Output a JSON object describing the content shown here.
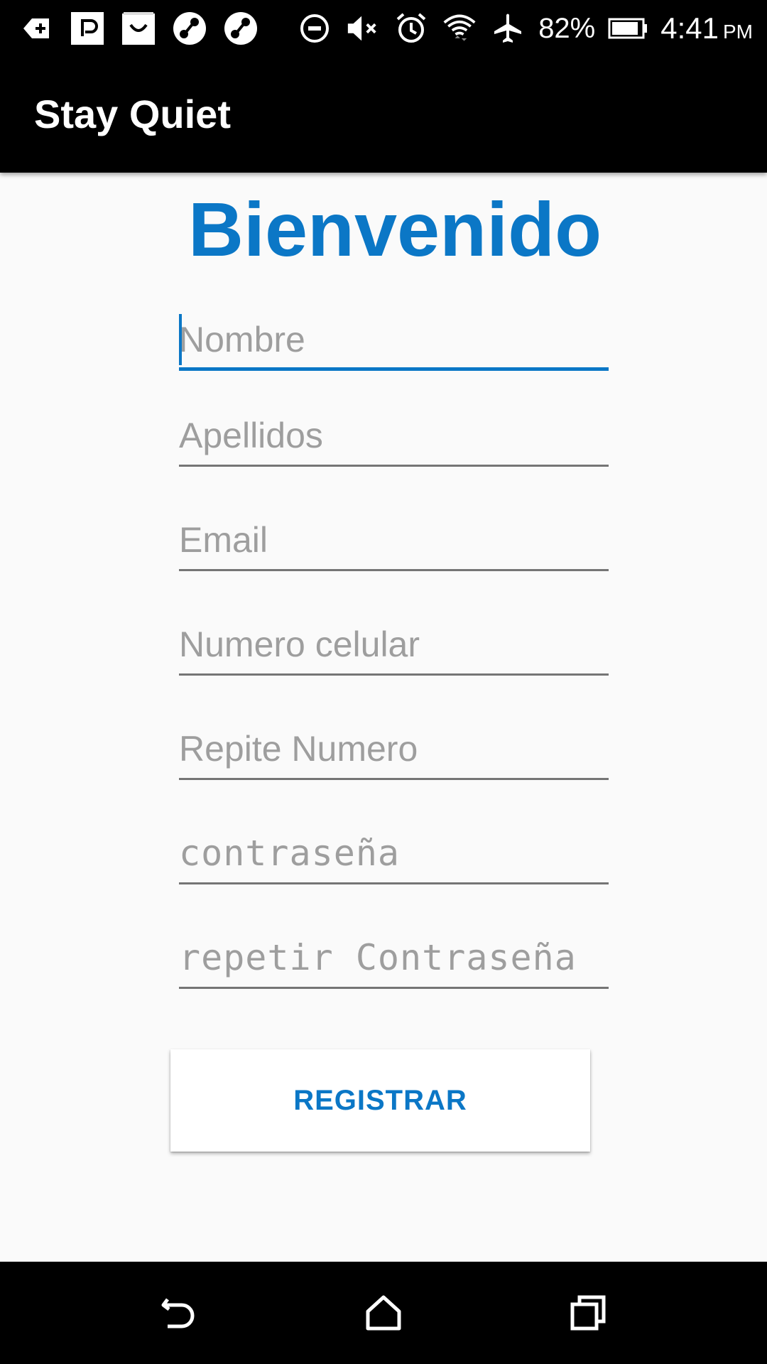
{
  "status_bar": {
    "battery_percent": "82%",
    "time": "4:41",
    "ampm": "PM",
    "left_icons": [
      "notification-plus-icon",
      "app-notification-icon",
      "shopping-bag-icon",
      "music-app-icon",
      "music-app-icon"
    ],
    "right_icons": [
      "do-not-disturb-icon",
      "mute-icon",
      "alarm-icon",
      "wifi-icon",
      "airplane-mode-icon",
      "battery-icon"
    ]
  },
  "app_bar": {
    "title": "Stay Quiet"
  },
  "form": {
    "heading": "Bienvenido",
    "fields": [
      {
        "placeholder": "Nombre",
        "value": ""
      },
      {
        "placeholder": "Apellidos",
        "value": ""
      },
      {
        "placeholder": "Email",
        "value": ""
      },
      {
        "placeholder": "Numero celular",
        "value": ""
      },
      {
        "placeholder": "Repite Numero",
        "value": ""
      },
      {
        "placeholder": "contraseña",
        "value": ""
      },
      {
        "placeholder": "repetir Contraseña",
        "value": ""
      }
    ],
    "submit_label": "REGISTRAR"
  },
  "nav_bar": {
    "icons": [
      "back-icon",
      "home-icon",
      "recents-icon"
    ]
  },
  "colors": {
    "accent": "#0b77c6",
    "bar_background": "#000000",
    "page_background": "#fafafa",
    "placeholder": "#9e9e9e",
    "underline": "#757575"
  }
}
